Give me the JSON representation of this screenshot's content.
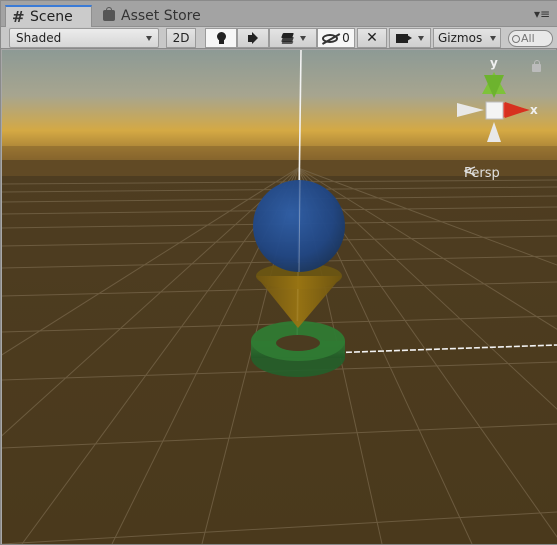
{
  "tabs": [
    {
      "label": "Scene",
      "icon": "hash-icon",
      "active": true
    },
    {
      "label": "Asset Store",
      "icon": "shopping-bag-icon",
      "active": false
    }
  ],
  "toolbar": {
    "shading_mode": "Shaded",
    "mode_2d_label": "2D",
    "hidden_count": "0",
    "gizmos_label": "Gizmos",
    "search_placeholder": "All"
  },
  "orientation_gizmo": {
    "y_label": "y",
    "x_label": "x",
    "projection_label": "Persp",
    "colors": {
      "x": "#e63b2e",
      "y": "#7ec23a",
      "z": "#4a78d6"
    }
  },
  "scene_colors": {
    "sky_top": "#8f9b93",
    "horizon": "#c99a3a",
    "ground": "#4b3a1e",
    "grid": "#6d5d44",
    "sphere": "#234a87",
    "cone": "#8a6a12",
    "torus": "#2c6b2f"
  }
}
